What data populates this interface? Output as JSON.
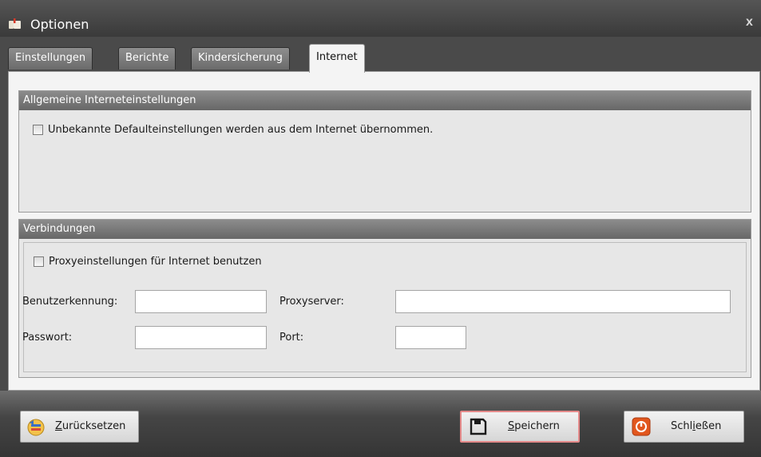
{
  "window": {
    "title": "Optionen",
    "close_glyph": "x"
  },
  "tabs": [
    {
      "label": "Einstellungen",
      "active": false
    },
    {
      "label": "Berichte",
      "active": false
    },
    {
      "label": "Kindersicherung",
      "active": false
    },
    {
      "label": "Internet",
      "active": true
    }
  ],
  "general": {
    "header": "Allgemeine Interneteinstellungen",
    "checkbox_label": "Unbekannte Defaulteinstellungen werden aus dem Internet übernommen.",
    "checked": false
  },
  "connections": {
    "header": "Verbindungen",
    "proxy_checkbox_label": "Proxyeinstellungen für Internet benutzen",
    "proxy_checked": false,
    "username_label": "Benutzerkennung:",
    "username_value": "",
    "password_label": "Passwort:",
    "password_value": "",
    "proxyserver_label": "Proxyserver:",
    "proxyserver_value": "",
    "port_label": "Port:",
    "port_value": ""
  },
  "footer": {
    "reset": {
      "mnemonic": "Z",
      "rest": "urücksetzen",
      "icon": "reset-icon"
    },
    "save": {
      "mnemonic": "S",
      "rest": "peichern",
      "icon": "floppy-disk-icon"
    },
    "close": {
      "before": "Schl",
      "mnemonic": "i",
      "rest": "eßen",
      "icon": "power-icon"
    }
  },
  "colors": {
    "title_bar": "#3a3a3a",
    "group_header": "#676767",
    "save_highlight": "#e48a8a",
    "close_icon": "#e2571e"
  }
}
